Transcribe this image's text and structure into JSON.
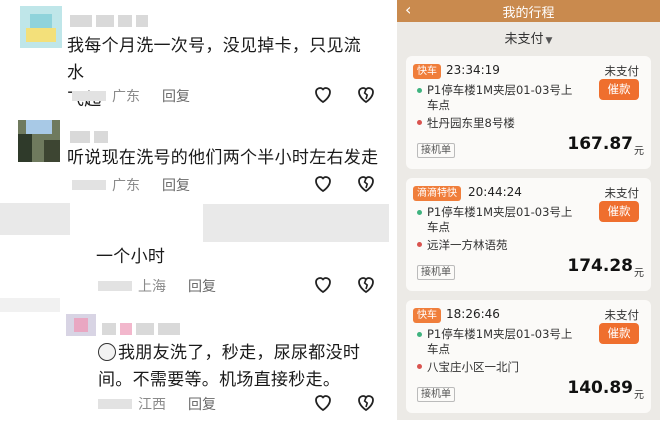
{
  "comments": [
    {
      "text_line1": "我每个月洗一次号，没见掉卡，只见流水",
      "text_line2": "飞起",
      "location": "广东",
      "reply_label": "回复"
    },
    {
      "text_line1": "听说现在洗号的他们两个半小时左右发走",
      "location": "广东",
      "reply_label": "回复"
    },
    {
      "text_line1": "一个小时",
      "location": "上海",
      "reply_label": "回复"
    },
    {
      "text_line1": "我朋友洗了，秒走，尿尿都没时",
      "text_line2": "间。不需要等。机场直接秒走。",
      "location": "江西",
      "reply_label": "回复"
    }
  ],
  "phone": {
    "back_glyph": "‹",
    "title": "我的行程",
    "filter_label": "未支付",
    "orders": [
      {
        "tag": "快车",
        "time": "23:34:19",
        "status": "未支付",
        "pay_label": "催款",
        "from": "P1停车楼1M夹层01-03号上车点",
        "to": "牡丹园东里8号楼",
        "badge": "接机单",
        "price": "167.87",
        "unit": "元"
      },
      {
        "tag": "滴滴特快",
        "time": "20:44:24",
        "status": "未支付",
        "pay_label": "催款",
        "from": "P1停车楼1M夹层01-03号上车点",
        "to": "远洋一方林语苑",
        "badge": "接机单",
        "price": "174.28",
        "unit": "元"
      },
      {
        "tag": "快车",
        "time": "18:26:46",
        "status": "未支付",
        "pay_label": "催款",
        "from": "P1停车楼1M夹层01-03号上车点",
        "to": "八宝庄小区一北门",
        "badge": "接机单",
        "price": "140.89",
        "unit": "元"
      }
    ]
  },
  "icons": {
    "like": "heart-icon",
    "dislike": "broken-heart-icon"
  },
  "colors": {
    "accent_orange": "#ef6f2e",
    "titlebar": "#c98a4e",
    "meta_gray": "#8a8a8a",
    "green_dot": "#3fb37f",
    "red_dot": "#d9534f"
  }
}
